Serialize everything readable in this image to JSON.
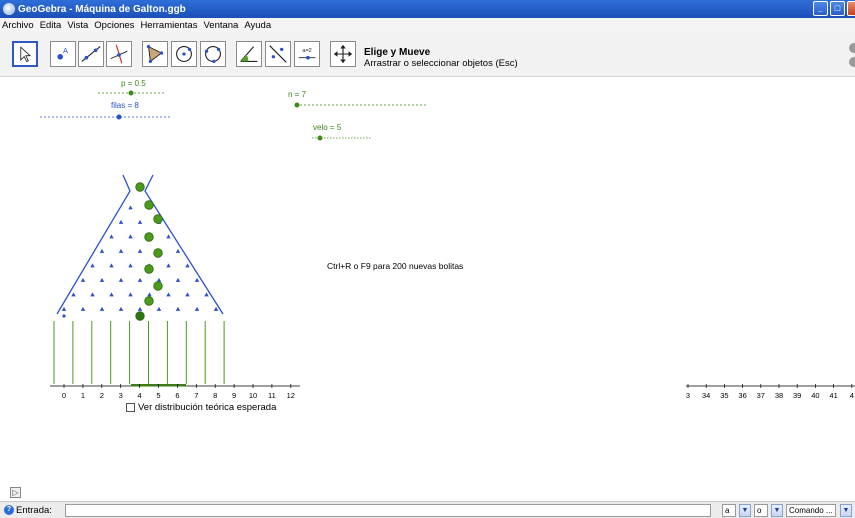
{
  "window": {
    "title": "GeoGebra - Máquina de Galton.ggb"
  },
  "menu": [
    "Archivo",
    "Edita",
    "Vista",
    "Opciones",
    "Herramientas",
    "Ventana",
    "Ayuda"
  ],
  "tool_info": {
    "name": "Elige y Mueve",
    "description": "Arrastrar o seleccionar objetos (Esc)"
  },
  "tools": [
    {
      "icon": "pointer-icon",
      "selected": true
    },
    {
      "icon": "point-icon"
    },
    {
      "icon": "line-icon"
    },
    {
      "icon": "perpendicular-line-icon"
    },
    {
      "icon": "polygon-icon"
    },
    {
      "icon": "circle-center-icon"
    },
    {
      "icon": "circle-three-points-icon"
    },
    {
      "icon": "angle-icon"
    },
    {
      "icon": "reflect-icon"
    },
    {
      "icon": "slider-icon",
      "text": "a=2"
    },
    {
      "icon": "move-graphics-icon"
    }
  ],
  "sliders": {
    "p": {
      "label": "p = 0.5",
      "value": 0.5
    },
    "filas": {
      "label": "filas = 8",
      "value": 8
    },
    "n": {
      "label": "n = 7",
      "value": 7
    },
    "velo": {
      "label": "velo = 5",
      "value": 5
    }
  },
  "canvas_text": {
    "instruction": "Ctrl+R o F9 para 200 nuevas bolitas"
  },
  "axis": {
    "ticks": [
      "0",
      "1",
      "2",
      "3",
      "4",
      "5",
      "6",
      "7",
      "8",
      "9",
      "10",
      "11",
      "12"
    ],
    "right_ticks": [
      "3",
      "34",
      "35",
      "36",
      "37",
      "38",
      "39",
      "40",
      "41",
      "4"
    ]
  },
  "checkbox": {
    "label": "Ver distribución teórica esperada",
    "checked": false
  },
  "inputbar": {
    "label": "Entrada:",
    "value": "",
    "symbol_a": "a",
    "symbol_b": "o",
    "command_placeholder": "Comando ..."
  },
  "colors": {
    "board": "#2a50d0",
    "ball": "#4b9a1c",
    "ball_outline": "#2f6a10",
    "slider_green": "#3f8a1a",
    "slider_blue": "#2a50d0",
    "bins": "#4b9a1c"
  }
}
